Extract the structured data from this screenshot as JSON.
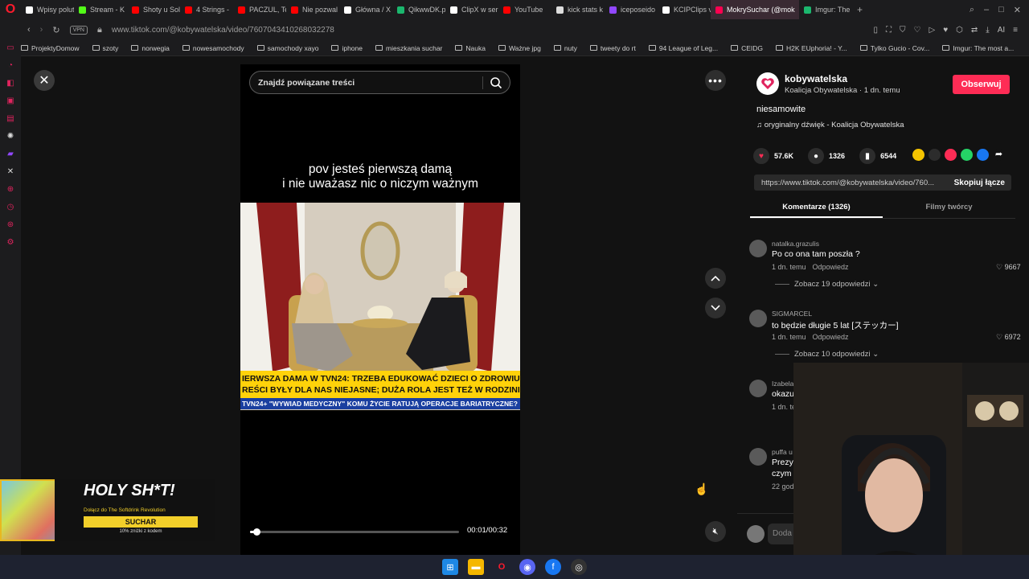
{
  "browser": {
    "tabs": [
      {
        "label": "Wpisy polut",
        "color": "#ffffff"
      },
      {
        "label": "Stream - K",
        "color": "#53fc18"
      },
      {
        "label": "Shoty u Sol",
        "color": "#ff0000"
      },
      {
        "label": "4 Strings -",
        "color": "#ff0000"
      },
      {
        "label": "PACZUL, Te",
        "color": "#ff0000"
      },
      {
        "label": "Nie pozwal",
        "color": "#ff0000"
      },
      {
        "label": "Główna / X",
        "color": "#ffffff"
      },
      {
        "label": "QikwwDK.p",
        "color": "#1bb76e"
      },
      {
        "label": "ClipX w ser",
        "color": "#ffffff"
      },
      {
        "label": "YouTube",
        "color": "#ff0000"
      },
      {
        "label": "kick stats k",
        "color": "#dddddd"
      },
      {
        "label": "iceposeido",
        "color": "#9147ff"
      },
      {
        "label": "KCIPClips v",
        "color": "#ffffff"
      },
      {
        "label": "MokrySuchar (@mok",
        "color": "#ff0050"
      },
      {
        "label": "Imgur: The",
        "color": "#1bb76e"
      }
    ],
    "active_tab_index": 13,
    "url": "www.tiktok.com/@kobywatelska/video/7607043410268032278",
    "vpn": "VPN",
    "ai_label": "AI",
    "bookmarks": [
      "ProjektyDomow",
      "szoty",
      "norwegia",
      "nowesamochody",
      "samochody xayo",
      "iphone",
      "mieszkania suchar",
      "Nauka",
      "Ważne jpg",
      "nuty",
      "tweety do rt",
      "94 League of Leg...",
      "CEIDG",
      "H2K EUphoria! - Y...",
      "Tylko Gucio - Cov...",
      "Imgur: The most a..."
    ]
  },
  "player": {
    "search_placeholder": "Znajdź powiązane treści",
    "caption_line1": "pov jesteś pierwszą damą",
    "caption_line2": "i nie uważasz nic o niczym ważnym",
    "ticker_line1": "IERWSZA DAMA W TVN24: TRZEBA EDUKOWAĆ DZIECI O ZDROWIU,",
    "ticker_line2": "REŚCI BYŁY DLA NAS NIEJASNE; DUŻA ROLA JEST TEŻ W RODZINIE",
    "ticker_bottom": "TVN24+   \"WYWIAD MEDYCZNY\"  KOMU ŻYCIE RATUJĄ OPERACJE BARIATRYCZNE?",
    "time": "00:01/00:32",
    "progress": 0.03
  },
  "promo": {
    "headline": "HOLY SH*T!",
    "sub": "Dołącz do The Softdrink Revolution",
    "code": "SUCHAR",
    "discount": "10% zniżki z kodem"
  },
  "panel": {
    "author": "kobywatelska",
    "author_sub": "Koalicja Obywatelska · 1 dn. temu",
    "follow": "Obserwuj",
    "description": "niesamowite",
    "sound": "♫  oryginalny dźwięk - Koalicja Obywatelska",
    "likes": "57.6K",
    "comments_count": "1326",
    "saves": "6544",
    "link": "https://www.tiktok.com/@kobywatelska/video/760...",
    "copy": "Skopiuj łącze",
    "tab_comments": "Komentarze (1326)",
    "tab_creator": "Filmy twórcy",
    "add_comment": "Doda",
    "comments": [
      {
        "user": "natalka.grazulis",
        "text": "Po co ona tam poszła ?",
        "time": "1 dn. temu",
        "reply": "Odpowiedz",
        "likes": "9667",
        "replies": "Zobacz 19 odpowiedzi"
      },
      {
        "user": "SIGMARCEL",
        "text": "to będzie długie 5 lat [ステッカー]",
        "time": "1 dn. temu",
        "reply": "Odpowiedz",
        "likes": "6972",
        "replies": "Zobacz 10 odpowiedzi"
      },
      {
        "user": "Izabela",
        "text": "okazu",
        "time": "1 dn. te",
        "reply": "",
        "likes": "",
        "replies": ""
      },
      {
        "user": "puffa u",
        "text": "Prezy",
        "text2": "czym",
        "time": "22 god",
        "reply": "",
        "likes": "",
        "replies": ""
      }
    ]
  }
}
